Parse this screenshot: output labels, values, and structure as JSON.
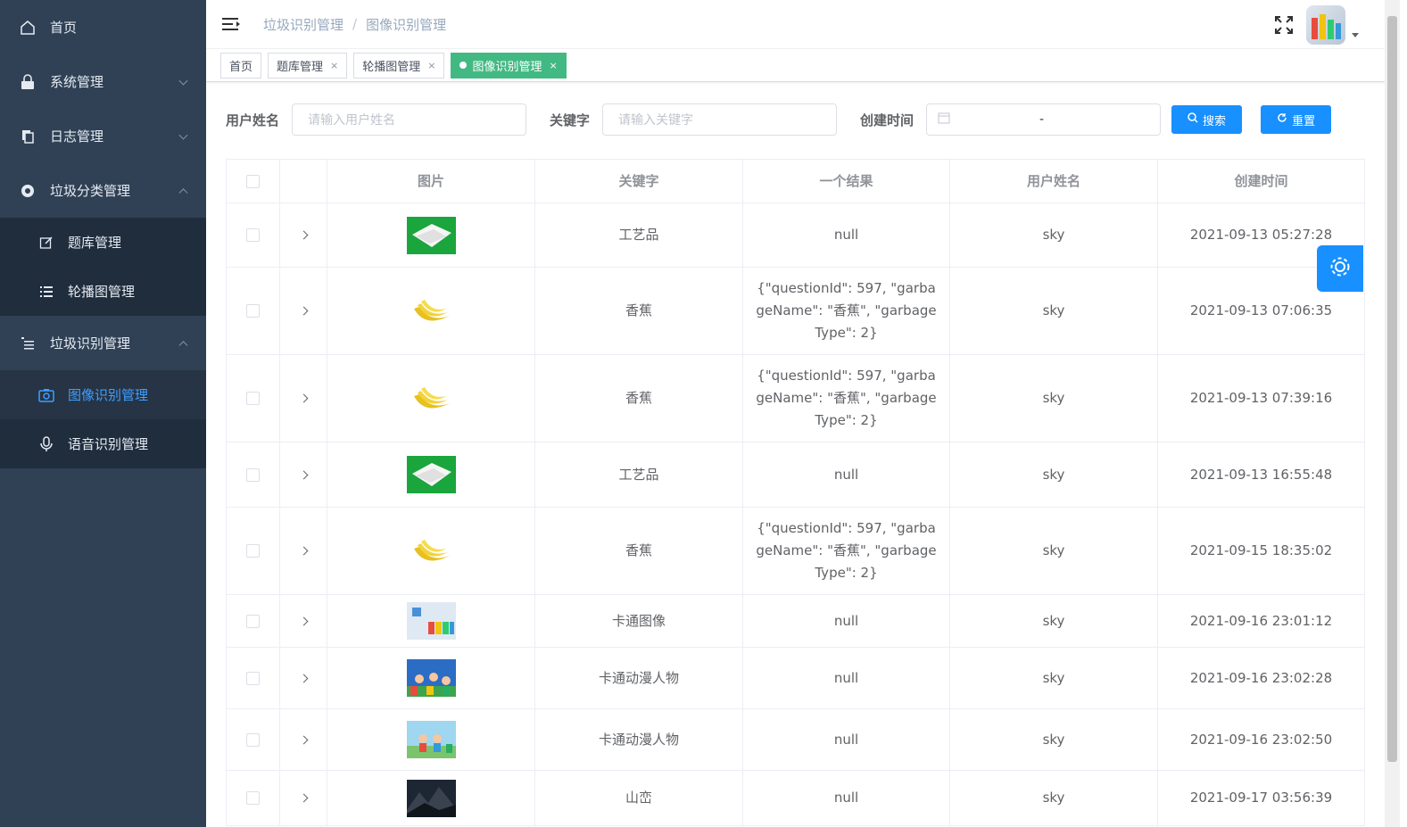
{
  "sidebar": {
    "home": "首页",
    "system": "系统管理",
    "log": "日志管理",
    "garbage_class": "垃圾分类管理",
    "question_bank": "题库管理",
    "carousel": "轮播图管理",
    "garbage_recog": "垃圾识别管理",
    "image_recog": "图像识别管理",
    "voice_recog": "语音识别管理"
  },
  "breadcrumb": [
    "垃圾识别管理",
    "/",
    "图像识别管理"
  ],
  "tags": [
    {
      "label": "首页",
      "closable": false,
      "active": false
    },
    {
      "label": "题库管理",
      "closable": true,
      "active": false
    },
    {
      "label": "轮播图管理",
      "closable": true,
      "active": false
    },
    {
      "label": "图像识别管理",
      "closable": true,
      "active": true
    }
  ],
  "tag_close": "×",
  "search": {
    "username_label": "用户姓名",
    "username_placeholder": "请输入用户姓名",
    "keyword_label": "关键字",
    "keyword_placeholder": "请输入关键字",
    "time_label": "创建时间",
    "time_sep": "-",
    "search_btn": "搜索",
    "reset_btn": "重置"
  },
  "table": {
    "headers": [
      "图片",
      "关键字",
      "一个结果",
      "用户姓名",
      "创建时间"
    ],
    "rows": [
      {
        "img": "styrofoam",
        "keyword": "工艺品",
        "result": "null",
        "user": "sky",
        "time": "2021-09-13 05:27:28"
      },
      {
        "img": "banana",
        "keyword": "香蕉",
        "result": "{\"questionId\": 597, \"garbageName\": \"香蕉\", \"garbageType\": 2}",
        "user": "sky",
        "time": "2021-09-13 07:06:35"
      },
      {
        "img": "banana",
        "keyword": "香蕉",
        "result": "{\"questionId\": 597, \"garbageName\": \"香蕉\", \"garbageType\": 2}",
        "user": "sky",
        "time": "2021-09-13 07:39:16"
      },
      {
        "img": "styrofoam",
        "keyword": "工艺品",
        "result": "null",
        "user": "sky",
        "time": "2021-09-13 16:55:48"
      },
      {
        "img": "banana",
        "keyword": "香蕉",
        "result": "{\"questionId\": 597, \"garbageName\": \"香蕉\", \"garbageType\": 2}",
        "user": "sky",
        "time": "2021-09-15 18:35:02"
      },
      {
        "img": "cartoon",
        "keyword": "卡通图像",
        "result": "null",
        "user": "sky",
        "time": "2021-09-16 23:01:12"
      },
      {
        "img": "cartoon-characters",
        "keyword": "卡通动漫人物",
        "result": "null",
        "user": "sky",
        "time": "2021-09-16 23:02:28"
      },
      {
        "img": "cartoon-characters-2",
        "keyword": "卡通动漫人物",
        "result": "null",
        "user": "sky",
        "time": "2021-09-16 23:02:50"
      },
      {
        "img": "mountain",
        "keyword": "山峦",
        "result": "null",
        "user": "sky",
        "time": "2021-09-17 03:56:39"
      }
    ]
  },
  "colors": {
    "sidebar_bg": "#304156",
    "active_blue": "#409eff",
    "tag_green": "#42b983",
    "primary": "#1890ff"
  }
}
